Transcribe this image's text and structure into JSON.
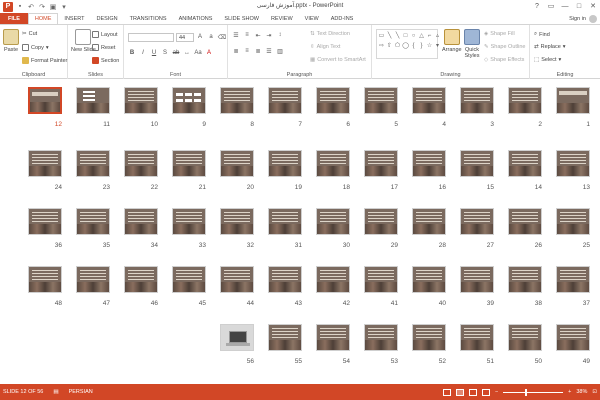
{
  "window": {
    "title": "آموزش فارسی.pptx - PowerPoint",
    "app_icon": "P",
    "controls": [
      "?",
      "▭",
      "—",
      "□",
      "✕"
    ]
  },
  "ribbon_tabs": [
    {
      "label": "FILE",
      "kind": "file"
    },
    {
      "label": "HOME",
      "kind": "active"
    },
    {
      "label": "INSERT"
    },
    {
      "label": "DESIGN"
    },
    {
      "label": "TRANSITIONS"
    },
    {
      "label": "ANIMATIONS"
    },
    {
      "label": "SLIDE SHOW"
    },
    {
      "label": "REVIEW"
    },
    {
      "label": "VIEW"
    },
    {
      "label": "ADD-INS"
    }
  ],
  "signin": "Sign in",
  "clipboard": {
    "label": "Clipboard",
    "paste": "Paste",
    "cut": "Cut",
    "copy": "Copy",
    "format_painter": "Format Painter"
  },
  "slides_group": {
    "label": "Slides",
    "new_slide": "New Slide",
    "layout": "Layout",
    "reset": "Reset",
    "section": "Section"
  },
  "font_group": {
    "label": "Font",
    "size_value": "44"
  },
  "paragraph_group": {
    "label": "Paragraph",
    "text_direction": "Text Direction",
    "align_text": "Align Text",
    "convert_smartart": "Convert to SmartArt"
  },
  "drawing_group": {
    "label": "Drawing",
    "arrange": "Arrange",
    "quick_styles": "Quick Styles",
    "shape_fill": "Shape Fill",
    "shape_outline": "Shape Outline",
    "shape_effects": "Shape Effects"
  },
  "editing_group": {
    "label": "Editing",
    "find": "Find",
    "replace": "Replace",
    "select": "Select"
  },
  "slides": {
    "selected": 12,
    "rows": [
      [
        12,
        11,
        10,
        9,
        8,
        7,
        6,
        5,
        4,
        3,
        2,
        1
      ],
      [
        24,
        23,
        22,
        21,
        20,
        19,
        18,
        17,
        16,
        15,
        14,
        13
      ],
      [
        36,
        35,
        34,
        33,
        32,
        31,
        30,
        29,
        28,
        27,
        26,
        25
      ],
      [
        48,
        47,
        46,
        45,
        44,
        43,
        42,
        41,
        40,
        39,
        38,
        37
      ],
      [
        56,
        55,
        54,
        53,
        52,
        51,
        50,
        49
      ]
    ]
  },
  "status": {
    "slide_info": "SLIDE 12 OF 56",
    "language": "PERSIAN",
    "zoom": "38%",
    "zoom_fraction": 0.38
  },
  "colors": {
    "accent": "#D24726"
  }
}
